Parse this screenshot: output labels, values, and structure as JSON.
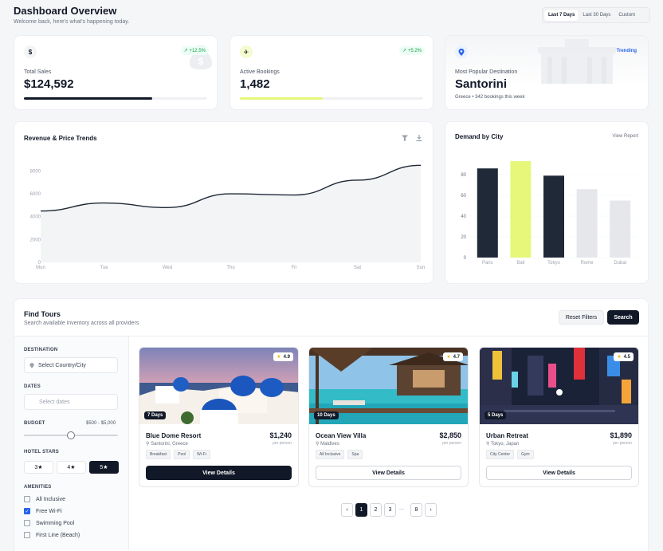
{
  "header": {
    "title": "Dashboard Overview",
    "subtitle": "Welcome back, here's what's happening today.",
    "ranges": [
      "Last 7 Days",
      "Last 30 Days",
      "Custom"
    ],
    "active_range": "Last 7 Days"
  },
  "stats": {
    "sales": {
      "label": "Total Sales",
      "value": "$124,592",
      "change": "+12.5%",
      "progress": 0.7
    },
    "bookings": {
      "label": "Active Bookings",
      "value": "1,482",
      "change": "+5.2%",
      "progress": 0.45
    },
    "destination": {
      "label": "Most Popular Destination",
      "value": "Santorini",
      "detail": "Greece • 342 bookings this week",
      "badge": "Trending"
    }
  },
  "revenue_chart": {
    "title": "Revenue & Price Trends",
    "chart_data": {
      "type": "area",
      "categories": [
        "Mon",
        "Tue",
        "Wed",
        "Thu",
        "Fri",
        "Sat",
        "Sun"
      ],
      "values": [
        4500,
        5200,
        4800,
        6000,
        5900,
        7200,
        8500
      ],
      "yticks": [
        0,
        2000,
        4000,
        6000,
        8000
      ],
      "ylim": [
        0,
        9500
      ],
      "grid": false
    }
  },
  "demand_chart": {
    "title": "Demand by City",
    "link": "View Report",
    "chart_data": {
      "type": "bar",
      "categories": [
        "Paris",
        "Bali",
        "Tokyo",
        "Rome",
        "Dubai"
      ],
      "values": [
        86,
        93,
        79,
        66,
        55
      ],
      "yticks": [
        0,
        20,
        40,
        60,
        80
      ],
      "ylim": [
        0,
        100
      ],
      "colors": [
        "#1f2937",
        "#e6f77a",
        "#1f2937",
        "#e5e7eb",
        "#e5e7eb"
      ],
      "grid": true
    }
  },
  "tours": {
    "title": "Find Tours",
    "subtitle": "Search available inventory across all providers",
    "reset_label": "Reset Filters",
    "search_label": "Search",
    "filters": {
      "destination_label": "DESTINATION",
      "destination_value": "Select Country/City",
      "dates_label": "DATES",
      "dates_placeholder": "Select dates",
      "budget_label": "BUDGET",
      "budget_range": "$500 - $5,000",
      "budget_position": 0.5,
      "stars_label": "HOTEL STARS",
      "stars": [
        "3★",
        "4★",
        "5★"
      ],
      "active_star": "5★",
      "amenities_label": "AMENITIES",
      "amenities": [
        {
          "label": "All Inclusive",
          "checked": false
        },
        {
          "label": "Free Wi-Fi",
          "checked": true
        },
        {
          "label": "Swimming Pool",
          "checked": false
        },
        {
          "label": "First Line (Beach)",
          "checked": false
        }
      ]
    },
    "cards": [
      {
        "name": "Blue Dome Resort",
        "location": "Santorini, Greece",
        "price": "$1,240",
        "per": "per person",
        "rating": "4.9",
        "days": "7 Days",
        "tags": [
          "Breakfast",
          "Pool",
          "Wi-Fi"
        ],
        "button": "View Details"
      },
      {
        "name": "Ocean View Villa",
        "location": "Maldives",
        "price": "$2,850",
        "per": "per person",
        "rating": "4.7",
        "days": "10 Days",
        "tags": [
          "All Inclusive",
          "Spa"
        ],
        "button": "View Details"
      },
      {
        "name": "Urban Retreat",
        "location": "Tokyo, Japan",
        "price": "$1,890",
        "per": "per person",
        "rating": "4.5",
        "days": "5 Days",
        "tags": [
          "City Center",
          "Gym"
        ],
        "button": "View Details"
      }
    ],
    "pagination": {
      "pages": [
        "1",
        "2",
        "3",
        "...",
        "8"
      ],
      "active": "1"
    }
  }
}
